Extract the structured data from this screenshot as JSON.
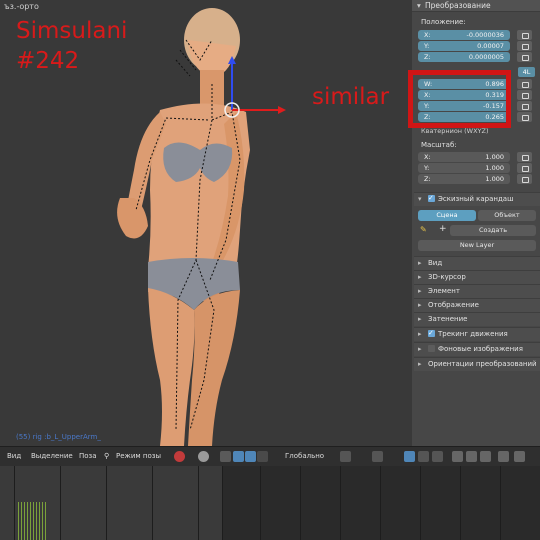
{
  "viewport": {
    "title": "ъз.-орто",
    "watermark_line1": "Simsulani",
    "watermark_line2": "#242",
    "annotation": "similar",
    "object_label": "(55) rig :b_L_UpperArm_"
  },
  "panel": {
    "transform_header": "Преобразование",
    "location_label": "Положение:",
    "location": [
      {
        "axis": "X:",
        "value": "-0.0000036"
      },
      {
        "axis": "Y:",
        "value": "0.00007"
      },
      {
        "axis": "Z:",
        "value": "0.0000005"
      }
    ],
    "rotation_mode_badge": "4L",
    "rotation": [
      {
        "axis": "W:",
        "value": "0.896"
      },
      {
        "axis": "X:",
        "value": "0.319"
      },
      {
        "axis": "Y:",
        "value": "-0.157"
      },
      {
        "axis": "Z:",
        "value": "0.265"
      }
    ],
    "rotation_mode_label": "Кватернион (WXYZ)",
    "scale_label": "Масштаб:",
    "scale": [
      {
        "axis": "X:",
        "value": "1.000"
      },
      {
        "axis": "Y:",
        "value": "1.000"
      },
      {
        "axis": "Z:",
        "value": "1.000"
      }
    ],
    "grease_pencil_header": "Эскизный карандаш",
    "tab_scene": "Сцена",
    "tab_object": "Объект",
    "create_label": "Создать",
    "new_layer_label": "New Layer",
    "sections": [
      {
        "label": "Вид",
        "checkbox": null
      },
      {
        "label": "3D-курсор",
        "checkbox": null
      },
      {
        "label": "Элемент",
        "checkbox": null
      },
      {
        "label": "Отображение",
        "checkbox": null
      },
      {
        "label": "Затенение",
        "checkbox": null
      },
      {
        "label": "Трекинг движения",
        "checkbox": true
      },
      {
        "label": "Фоновые изображения",
        "checkbox": false
      },
      {
        "label": "Ориентации преобразований",
        "checkbox": null
      }
    ]
  },
  "toolbar": {
    "view": "Вид",
    "select": "Выделение",
    "pose": "Поза",
    "mode": "Режим позы",
    "orientation": "Глобально"
  },
  "colors": {
    "accent_field": "#5a8fa5",
    "annotation_red": "#d81a1a",
    "skin": "#e0a27a",
    "underwear": "#8a8e98"
  }
}
